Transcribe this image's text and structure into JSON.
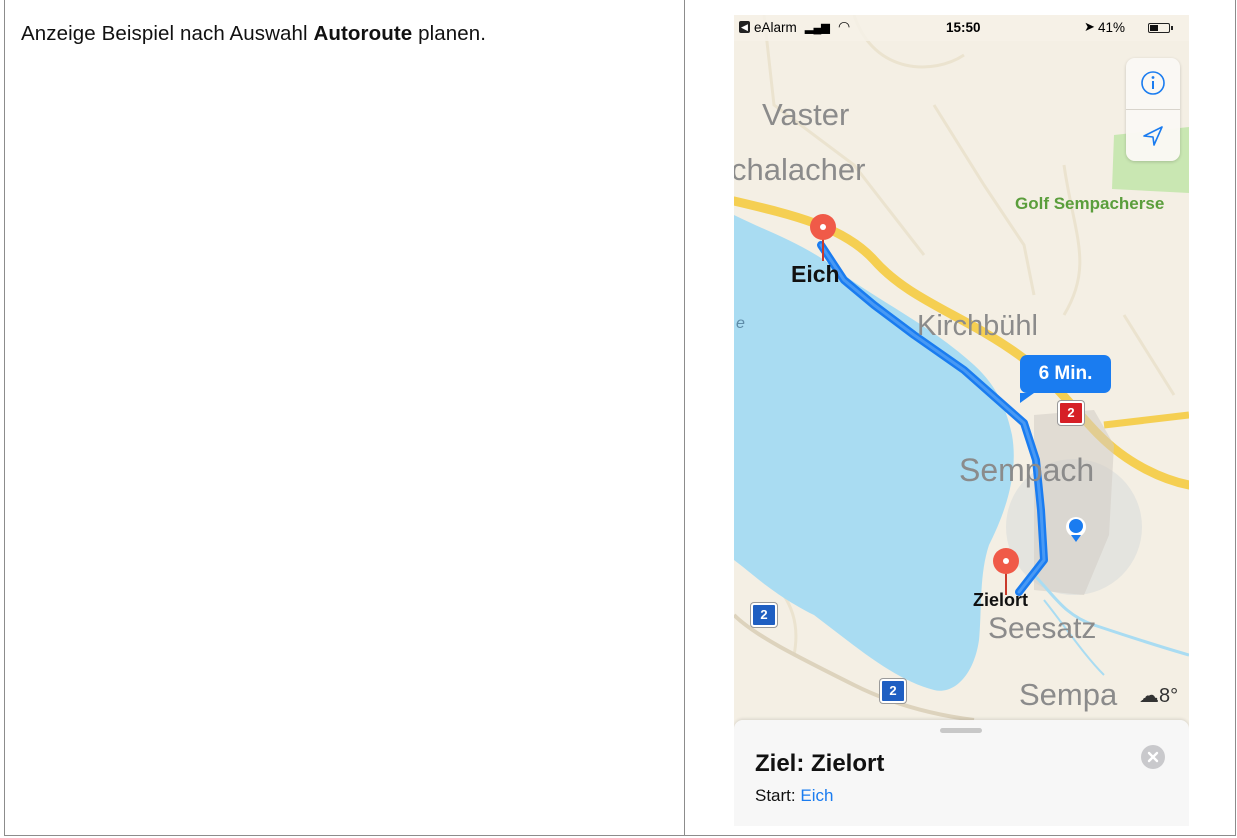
{
  "caption": {
    "prefix": "Anzeige Beispiel nach Auswahl ",
    "bold": "Autoroute",
    "suffix": " planen."
  },
  "statusbar": {
    "app": "eAlarm",
    "time": "15:50",
    "battery": "41%"
  },
  "map": {
    "labels": {
      "vaster": "Vaster",
      "chalacher": "chalacher",
      "golf": "Golf Sempacherse",
      "eich": "Eich",
      "kirchbuehl": "Kirchbühl",
      "sempach": "Sempach",
      "zielort": "Zielort",
      "seesatz": "Seesatz",
      "sempa": "Sempa",
      "edge_e": "e"
    },
    "route_time": "6 Min.",
    "road_shield": "2",
    "weather": "8°",
    "colors": {
      "route": "#1a7cf0",
      "water": "#a9dcf2",
      "land": "#f4efe4",
      "motorway": "#f5cf52",
      "pin": "#f05a48",
      "golf": "#c9e7b2"
    }
  },
  "sheet": {
    "title": "Ziel: Zielort",
    "start_label": "Start:",
    "start_value": "Eich"
  }
}
